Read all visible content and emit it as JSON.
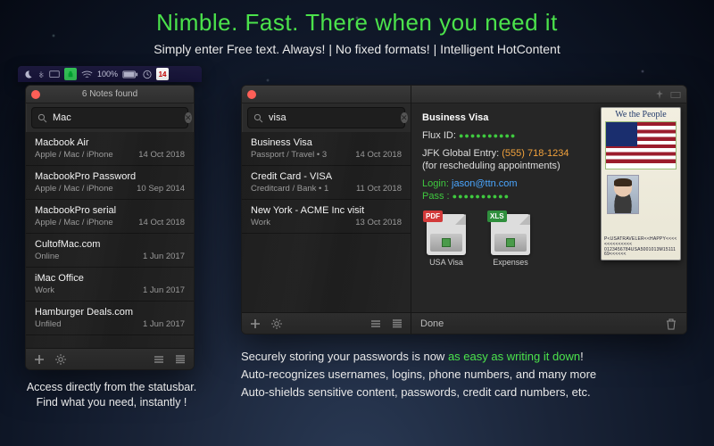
{
  "hero": {
    "headline": "Nimble. Fast. There when you need it",
    "subhead": "Simply enter Free text. Always!  |  No fixed formats!  |  Intelligent HotContent"
  },
  "menubar": {
    "battery": "100%",
    "calendar_day": "14"
  },
  "winA": {
    "title": "6 Notes found",
    "search_value": "Mac",
    "rows": [
      {
        "title": "Macbook Air",
        "meta": "Apple / Mac / iPhone",
        "date": "14 Oct 2018"
      },
      {
        "title": "MacbookPro Password",
        "meta": "Apple / Mac / iPhone",
        "date": "10 Sep 2014"
      },
      {
        "title": "MacbookPro serial",
        "meta": "Apple / Mac / iPhone",
        "date": "14 Oct 2018"
      },
      {
        "title": "CultofMac.com",
        "meta": "Online",
        "date": "1 Jun 2017"
      },
      {
        "title": "iMac Office",
        "meta": "Work",
        "date": "1 Jun 2017"
      },
      {
        "title": "Hamburger Deals.com",
        "meta": "Unfiled",
        "date": "1 Jun 2017"
      }
    ]
  },
  "winB": {
    "search_value": "visa",
    "rows": [
      {
        "title": "Business Visa",
        "meta": "Passport / Travel • 3",
        "date": "14 Oct 2018"
      },
      {
        "title": "Credit Card - VISA",
        "meta": "Creditcard / Bank • 1",
        "date": "11 Oct 2018"
      },
      {
        "title": "New York - ACME Inc visit",
        "meta": "Work",
        "date": "13 Oct 2018"
      }
    ],
    "detail": {
      "title": "Business Visa",
      "flux_label": "Flux ID:",
      "jfk_label": "JFK Global Entry:",
      "jfk_phone": "(555) 718-1234",
      "jfk_note": "(for rescheduling appointments)",
      "login_label": "Login:",
      "login_value": "jason@ttn.com",
      "pass_label": "Pass :",
      "files": [
        {
          "badge": "PDF",
          "badge_color": "#d23a3a",
          "label": "USA Visa"
        },
        {
          "badge": "XLS",
          "badge_color": "#2f8f3d",
          "label": "Expenses"
        }
      ],
      "done": "Done"
    },
    "passport": {
      "header": "We the People",
      "mrz1": "P<USATRAVELER<<HAPPY<<<<<<<<<<<<<<",
      "mrz2": "0123456784USA5001013M1511169<<<<<<"
    }
  },
  "captions": {
    "leftA": "Access directly from the statusbar.",
    "leftB": "Find what you need, instantly !",
    "r1a": "Securely storing your passwords is now ",
    "r1b": "as easy as writing it down",
    "r1c": "!",
    "r2": "Auto-recognizes usernames, logins, phone numbers, and many more",
    "r3": "Auto-shields sensitive content, passwords, credit card numbers, etc."
  }
}
